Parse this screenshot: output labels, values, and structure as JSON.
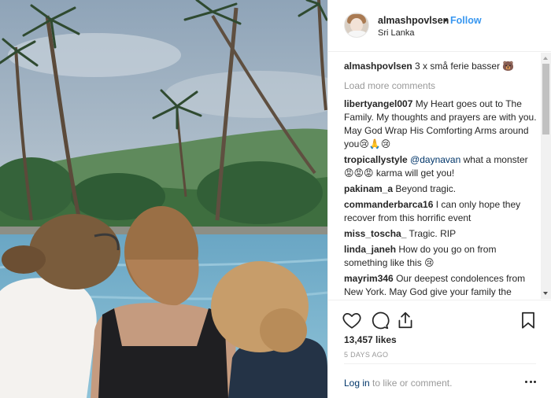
{
  "post": {
    "username": "almashpovlsen",
    "separator": "•",
    "follow_label": "Follow",
    "location": "Sri Lanka",
    "caption": {
      "username": "almashpovlsen",
      "text": "3 x små ferie basser 🐻"
    },
    "load_more_label": "Load more comments",
    "comments": [
      {
        "username": "libertyangel007",
        "mention": "",
        "text": "My Heart goes out to The Family. My thoughts and prayers are with you. May God Wrap His Comforting Arms around you😢🙏😢"
      },
      {
        "username": "tropicallystyle",
        "mention": "@daynavan",
        "text": "what a monster 😡😡😡 karma will get you!"
      },
      {
        "username": "pakinam_a",
        "mention": "",
        "text": "Beyond tragic."
      },
      {
        "username": "commanderbarca16",
        "mention": "",
        "text": "I can only hope they recover from this horrific event"
      },
      {
        "username": "miss_toscha_",
        "mention": "",
        "text": "Tragic. RIP"
      },
      {
        "username": "linda_janeh",
        "mention": "",
        "text": "How do you go on from something like this 😢"
      },
      {
        "username": "mayrim346",
        "mention": "",
        "text": "Our deepest condolences from New York. May God give your family the strength you need at this very sad moment. 🙏🙏"
      }
    ],
    "likes": "13,457 likes",
    "time_ago": "5 DAYS AGO",
    "login_link": "Log in",
    "login_suffix": " to like or comment."
  },
  "icons": {
    "like": "heart-icon",
    "comment": "comment-bubble-icon",
    "share": "share-icon",
    "save": "bookmark-icon",
    "more": "more-options-icon"
  },
  "colors": {
    "link_blue": "#3897f0",
    "text": "#262626",
    "muted": "#999999",
    "mention": "#003569"
  }
}
